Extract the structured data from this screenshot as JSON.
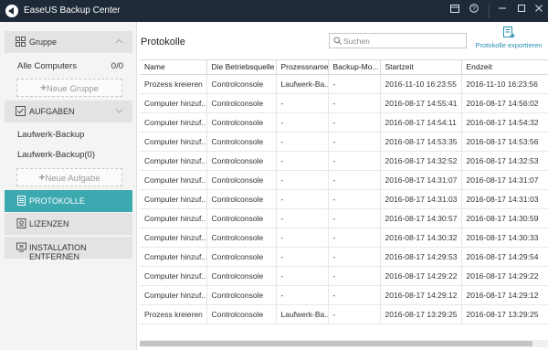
{
  "window": {
    "title": "EaseUS Backup Center"
  },
  "sidebar": {
    "group_header": "Gruppe",
    "all_computers": "Alle Computers",
    "all_computers_count": "0/0",
    "new_group": "Neue Gruppe",
    "tasks_header": "AUFGABEN",
    "tasks": [
      "Laufwerk-Backup",
      "Laufwerk-Backup(0)"
    ],
    "new_task": "Neue Aufgabe",
    "nav": {
      "logs": "PROTOKOLLE",
      "licenses": "LIZENZEN",
      "remove_install": "INSTALLATION ENTFERNEN"
    }
  },
  "main": {
    "title": "Protokolle",
    "search_placeholder": "Suchen",
    "export_label": "Protokolle exportieren",
    "columns": [
      "Name",
      "Die Betriebsquelle",
      "Prozessname",
      "Backup-Mo...",
      "Startzeit",
      "Endzeit"
    ],
    "rows": [
      [
        "Prozess kreieren",
        "Controlconsole",
        "Laufwerk-Ba...",
        "-",
        "2016-11-10 16:23:55",
        "2016-11-10 16:23:56"
      ],
      [
        "Computer hinzuf...",
        "Controlconsole",
        "-",
        "-",
        "2016-08-17 14:55:41",
        "2016-08-17 14:56:02"
      ],
      [
        "Computer hinzuf...",
        "Controlconsole",
        "-",
        "-",
        "2016-08-17 14:54:11",
        "2016-08-17 14:54:32"
      ],
      [
        "Computer hinzuf...",
        "Controlconsole",
        "-",
        "-",
        "2016-08-17 14:53:35",
        "2016-08-17 14:53:56"
      ],
      [
        "Computer hinzuf...",
        "Controlconsole",
        "-",
        "-",
        "2016-08-17 14:32:52",
        "2016-08-17 14:32:53"
      ],
      [
        "Computer hinzuf...",
        "Controlconsole",
        "-",
        "-",
        "2016-08-17 14:31:07",
        "2016-08-17 14:31:07"
      ],
      [
        "Computer hinzuf...",
        "Controlconsole",
        "-",
        "-",
        "2016-08-17 14:31:03",
        "2016-08-17 14:31:03"
      ],
      [
        "Computer hinzuf...",
        "Controlconsole",
        "-",
        "-",
        "2016-08-17 14:30:57",
        "2016-08-17 14:30:59"
      ],
      [
        "Computer hinzuf...",
        "Controlconsole",
        "-",
        "-",
        "2016-08-17 14:30:32",
        "2016-08-17 14:30:33"
      ],
      [
        "Computer hinzuf...",
        "Controlconsole",
        "-",
        "-",
        "2016-08-17 14:29:53",
        "2016-08-17 14:29:54"
      ],
      [
        "Computer hinzuf...",
        "Controlconsole",
        "-",
        "-",
        "2016-08-17 14:29:22",
        "2016-08-17 14:29:22"
      ],
      [
        "Computer hinzuf...",
        "Controlconsole",
        "-",
        "-",
        "2016-08-17 14:29:12",
        "2016-08-17 14:29:12"
      ],
      [
        "Prozess kreieren",
        "Controlconsole",
        "Laufwerk-Ba...",
        "-",
        "2016-08-17 13:29:25",
        "2016-08-17 13:29:25"
      ]
    ]
  },
  "colors": {
    "titlebar": "#1e2a38",
    "accent": "#3ca8b0",
    "link": "#2a8fb0"
  }
}
